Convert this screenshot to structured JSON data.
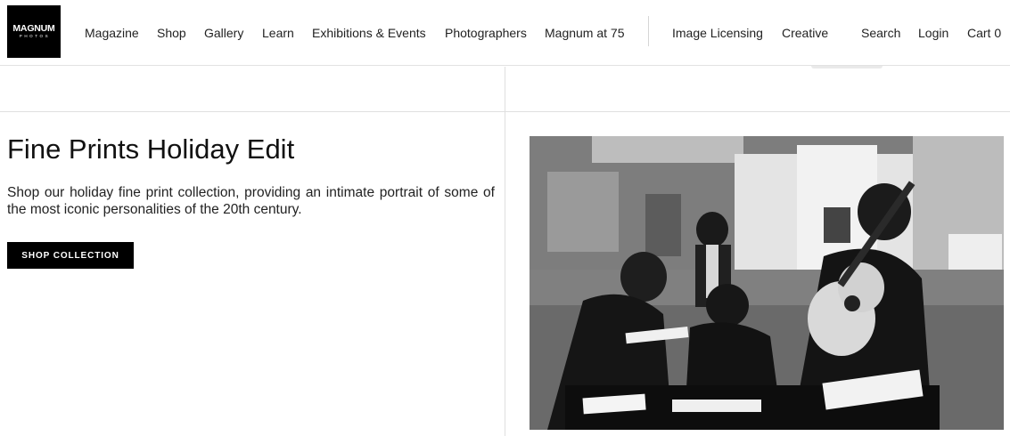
{
  "logo": {
    "main": "MAGNUM",
    "sub": "PHOTOS"
  },
  "nav": {
    "primary": [
      "Magazine",
      "Shop",
      "Gallery",
      "Learn",
      "Exhibitions & Events",
      "Photographers",
      "Magnum at 75"
    ],
    "secondary": [
      "Image Licensing",
      "Creative"
    ],
    "utility": [
      "Search",
      "Login",
      "Cart 0"
    ]
  },
  "feature": {
    "title": "Fine Prints Holiday Edit",
    "description": "Shop our holiday fine print collection, providing an intimate portrait of some of the most iconic personalities of the 20th century.",
    "button_label": "SHOP COLLECTION"
  },
  "colors": {
    "brand": "#000000",
    "text": "#111111",
    "divider": "#e0e0e0"
  }
}
